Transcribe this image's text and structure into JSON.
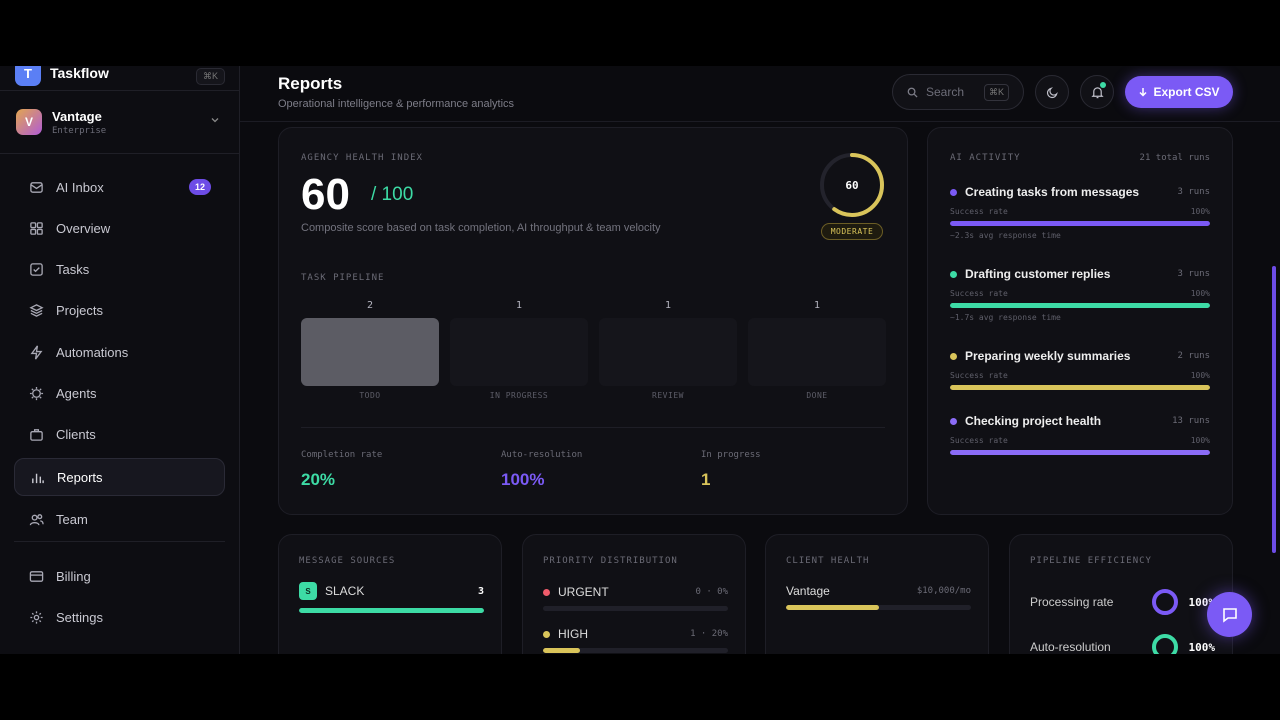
{
  "brand": {
    "name": "Taskflow",
    "logo_letter": "T",
    "shortcut": "⌘K"
  },
  "workspace": {
    "name": "Vantage",
    "plan": "Enterprise",
    "avatar_letter": "V"
  },
  "nav": [
    {
      "label": "AI Inbox",
      "icon": "inbox-icon",
      "badge": "12"
    },
    {
      "label": "Overview",
      "icon": "grid-icon"
    },
    {
      "label": "Tasks",
      "icon": "checkbox-icon"
    },
    {
      "label": "Projects",
      "icon": "layers-icon"
    },
    {
      "label": "Automations",
      "icon": "bolt-icon"
    },
    {
      "label": "Agents",
      "icon": "chip-icon"
    },
    {
      "label": "Clients",
      "icon": "briefcase-icon"
    },
    {
      "label": "Reports",
      "icon": "bar-chart-icon",
      "active": true
    },
    {
      "label": "Team",
      "icon": "users-icon"
    },
    {
      "label": "Billing",
      "icon": "card-icon"
    },
    {
      "label": "Settings",
      "icon": "gear-icon"
    }
  ],
  "header": {
    "title": "Reports",
    "subtitle": "Operational intelligence & performance analytics",
    "search_placeholder": "Search",
    "search_shortcut": "⌘K",
    "export_label": "Export CSV"
  },
  "health": {
    "label": "AGENCY HEALTH INDEX",
    "score": "60",
    "max": "/ 100",
    "score_value": 60,
    "description": "Composite score based on task completion, AI throughput & team velocity",
    "gauge_text": "60",
    "status": "MODERATE",
    "pipeline_label": "TASK PIPELINE",
    "pipeline": [
      {
        "count": "2",
        "name": "TODO",
        "filled": true
      },
      {
        "count": "1",
        "name": "IN PROGRESS"
      },
      {
        "count": "1",
        "name": "REVIEW"
      },
      {
        "count": "1",
        "name": "DONE"
      }
    ],
    "stats": [
      {
        "label": "Completion rate",
        "value": "20%",
        "color": "#3ddba5"
      },
      {
        "label": "Auto-resolution",
        "value": "100%",
        "color": "#7b5af5"
      },
      {
        "label": "In progress",
        "value": "1",
        "color": "#d9c45a"
      }
    ]
  },
  "ai_activity": {
    "label": "AI ACTIVITY",
    "total": "21 total runs",
    "items": [
      {
        "name": "Creating tasks from messages",
        "runs": "3 runs",
        "rate_label": "Success rate",
        "rate": "100%",
        "fill": 1.0,
        "color": "#7b5af5",
        "time": "~2.3s avg response time"
      },
      {
        "name": "Drafting customer replies",
        "runs": "3 runs",
        "rate_label": "Success rate",
        "rate": "100%",
        "fill": 1.0,
        "color": "#3ddba5",
        "time": "~1.7s avg response time"
      },
      {
        "name": "Preparing weekly summaries",
        "runs": "2 runs",
        "rate_label": "Success rate",
        "rate": "100%",
        "fill": 1.0,
        "color": "#d9c45a"
      },
      {
        "name": "Checking project health",
        "runs": "13 runs",
        "rate_label": "Success rate",
        "rate": "100%",
        "fill": 1.0,
        "color": "#8b6cf7"
      }
    ]
  },
  "message_sources": {
    "label": "MESSAGE SOURCES",
    "items": [
      {
        "icon_letter": "S",
        "name": "SLACK",
        "count": "3",
        "fill": 1.0,
        "color": "#3ddba5"
      }
    ]
  },
  "priority": {
    "label": "PRIORITY DISTRIBUTION",
    "items": [
      {
        "name": "URGENT",
        "value": "0 · 0%",
        "fill": 0.0,
        "color": "#f05c6b"
      },
      {
        "name": "HIGH",
        "value": "1 · 20%",
        "fill": 0.2,
        "color": "#d9c45a"
      }
    ]
  },
  "client_health": {
    "label": "CLIENT HEALTH",
    "items": [
      {
        "name": "Vantage",
        "value": "$10,000/mo",
        "fill": 0.5,
        "color": "#d9c45a"
      }
    ]
  },
  "pipeline_efficiency": {
    "label": "PIPELINE EFFICIENCY",
    "items": [
      {
        "name": "Processing rate",
        "value": "100%",
        "color": "#7b5af5"
      },
      {
        "name": "Auto-resolution",
        "value": "100%",
        "color": "#3ddba5"
      }
    ]
  }
}
